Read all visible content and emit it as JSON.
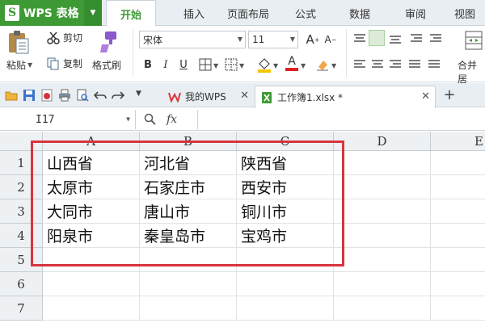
{
  "app": {
    "title": "WPS 表格",
    "logo_letter": "S"
  },
  "menu_tabs": [
    "开始",
    "插入",
    "页面布局",
    "公式",
    "数据",
    "审阅",
    "视图"
  ],
  "ribbon": {
    "paste_label": "粘贴",
    "cut_label": "剪切",
    "copy_label": "复制",
    "format_painter_label": "格式刷",
    "font_name": "宋体",
    "font_size": "11",
    "bold": "B",
    "italic": "I",
    "underline": "U",
    "merge_label": "合并居",
    "colors": {
      "fill": "#f5c400",
      "font": "#e02020",
      "accent": "#3d9a35"
    }
  },
  "doc_tabs": [
    {
      "label": "我的WPS"
    },
    {
      "label": "工作簿1.xlsx *"
    }
  ],
  "formula_bar": {
    "cell_ref": "I17",
    "fx_label": "fx",
    "value": ""
  },
  "columns": [
    "A",
    "B",
    "C",
    "D",
    "E"
  ],
  "rows": [
    "1",
    "2",
    "3",
    "4",
    "5",
    "6",
    "7"
  ],
  "cells": [
    [
      "山西省",
      "河北省",
      "陕西省"
    ],
    [
      "太原市",
      "石家庄市",
      "西安市"
    ],
    [
      "大同市",
      "唐山市",
      "铜川市"
    ],
    [
      "阳泉市",
      "秦皇岛市",
      "宝鸡市"
    ]
  ]
}
